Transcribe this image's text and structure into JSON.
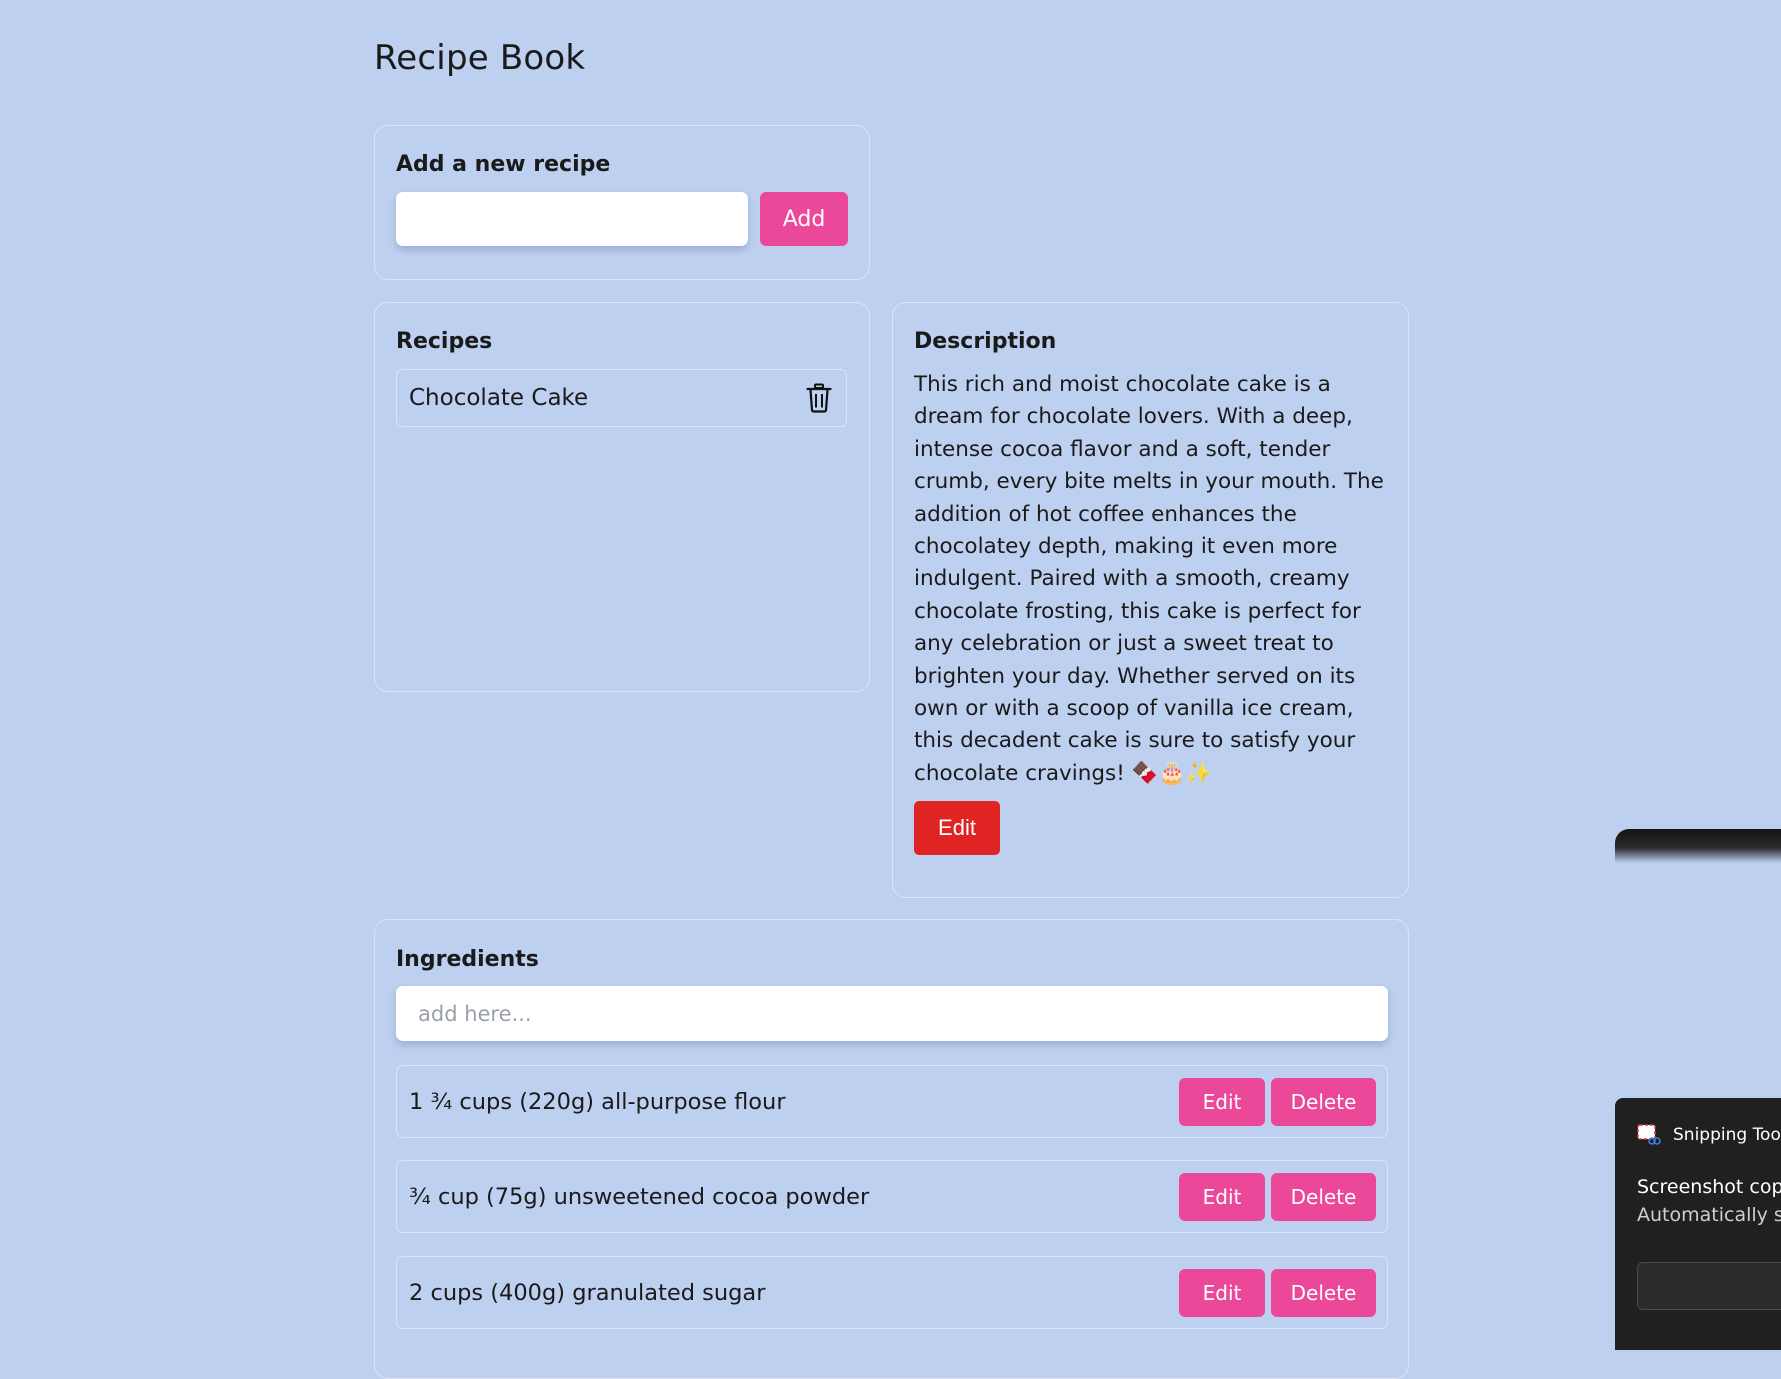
{
  "app": {
    "title": "Recipe Book"
  },
  "add_recipe": {
    "heading": "Add a new recipe",
    "input_value": "",
    "button_label": "Add"
  },
  "recipes": {
    "heading": "Recipes",
    "items": [
      {
        "name": "Chocolate Cake",
        "icon": "trash-icon"
      }
    ]
  },
  "description": {
    "heading": "Description",
    "text": "This rich and moist chocolate cake is a dream for chocolate lovers. With a deep, intense cocoa flavor and a soft, tender crumb, every bite melts in your mouth. The addition of hot coffee enhances the chocolatey depth, making it even more indulgent. Paired with a smooth, creamy chocolate frosting, this cake is perfect for any celebration or just a sweet treat to brighten your day. Whether served on its own or with a scoop of vanilla ice cream, this decadent cake is sure to satisfy your chocolate cravings! 🍫🎂✨",
    "edit_label": "Edit"
  },
  "ingredients": {
    "heading": "Ingredients",
    "input_placeholder": "add here...",
    "edit_label": "Edit",
    "delete_label": "Delete",
    "items": [
      {
        "text": "1 ¾ cups (220g) all-purpose flour"
      },
      {
        "text": "¾ cup (75g) unsweetened cocoa powder"
      },
      {
        "text": "2 cups (400g) granulated sugar"
      }
    ]
  },
  "notification": {
    "app_name": "Snipping Too",
    "title": "Screenshot cop",
    "subtitle": "Automatically s"
  },
  "colors": {
    "background": "#bdd0f0",
    "accent_pink": "#ec4899",
    "danger_red": "#e02424"
  }
}
